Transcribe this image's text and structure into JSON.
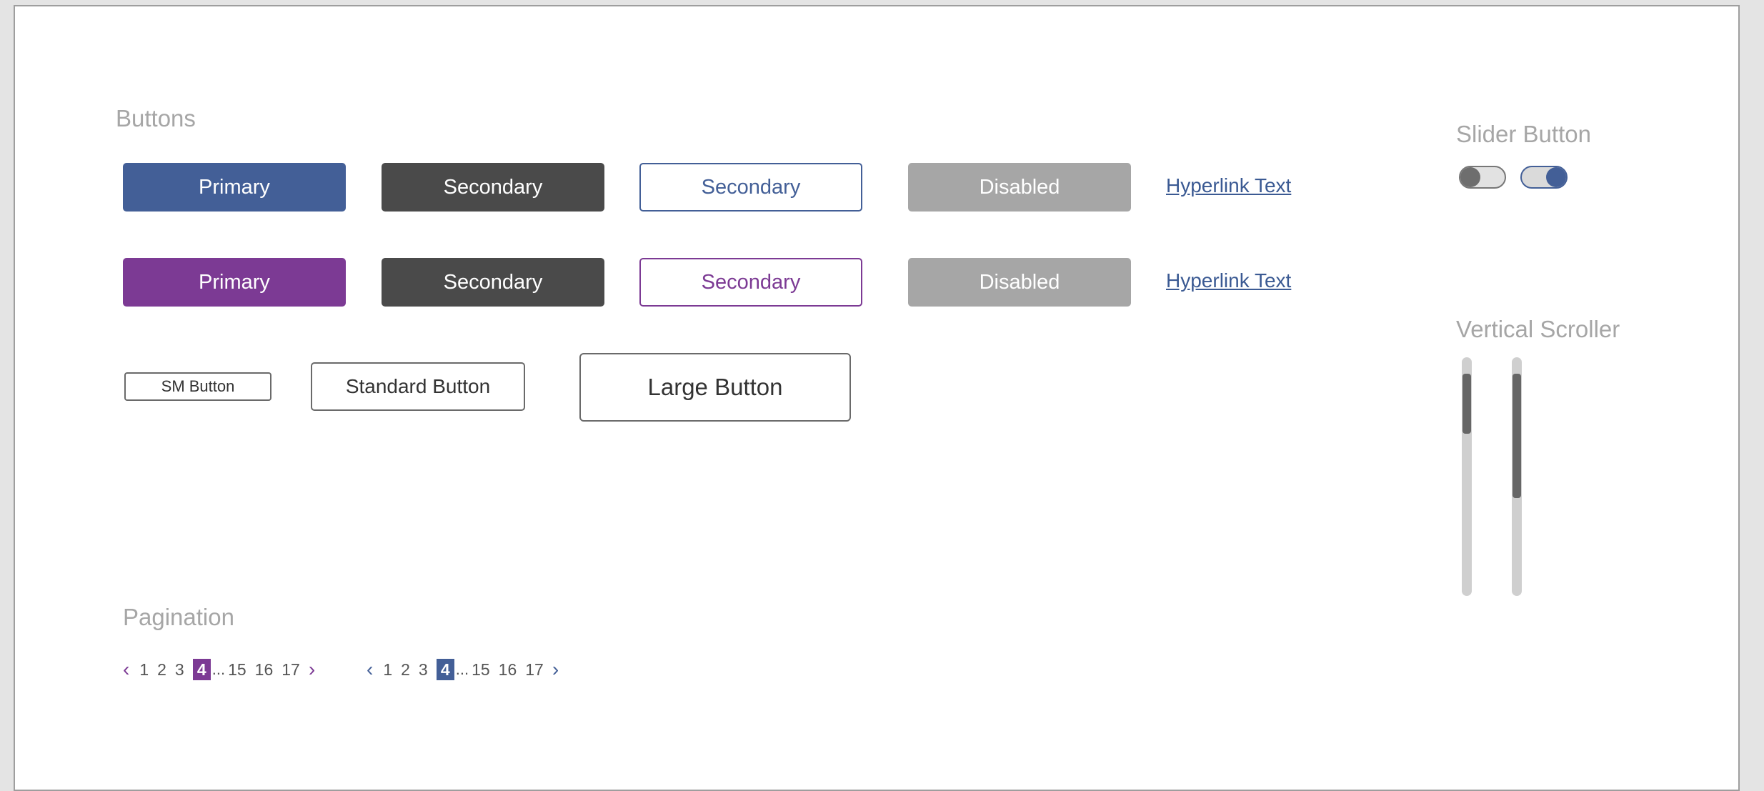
{
  "buttons_section": {
    "title": "Buttons",
    "row1": {
      "primary": "Primary",
      "secondary_filled": "Secondary",
      "secondary_outline": "Secondary",
      "disabled": "Disabled",
      "link": "Hyperlink Text"
    },
    "row2": {
      "primary": "Primary",
      "secondary_filled": "Secondary",
      "secondary_outline": "Secondary",
      "disabled": "Disabled",
      "link": "Hyperlink Text"
    },
    "sizes": {
      "small": "SM Button",
      "standard": "Standard Button",
      "large": "Large Button"
    }
  },
  "slider_section": {
    "title": "Slider Button",
    "toggles": [
      {
        "state": "off",
        "color": "#6e6e6e"
      },
      {
        "state": "on",
        "color": "#435f97"
      }
    ]
  },
  "scroller_section": {
    "title": "Vertical Scroller",
    "scrollers": [
      {
        "thumb_start": 0.07,
        "thumb_end": 0.32
      },
      {
        "thumb_start": 0.07,
        "thumb_end": 0.59
      }
    ]
  },
  "pagination_section": {
    "title": "Pagination",
    "pagers": [
      {
        "pages_before": [
          "1",
          "2",
          "3"
        ],
        "current": "4",
        "ellipsis": "...",
        "pages_after": [
          "15",
          "16",
          "17"
        ],
        "accent": "#7c3a94"
      },
      {
        "pages_before": [
          "1",
          "2",
          "3"
        ],
        "current": "4",
        "ellipsis": "...",
        "pages_after": [
          "15",
          "16",
          "17"
        ],
        "accent": "#435f97"
      }
    ]
  },
  "colors": {
    "primary_blue": "#435f97",
    "primary_purple": "#7c3a94",
    "secondary_dark": "#4a4a4a",
    "disabled_gray": "#a6a6a6",
    "link_blue": "#3b5a93"
  }
}
